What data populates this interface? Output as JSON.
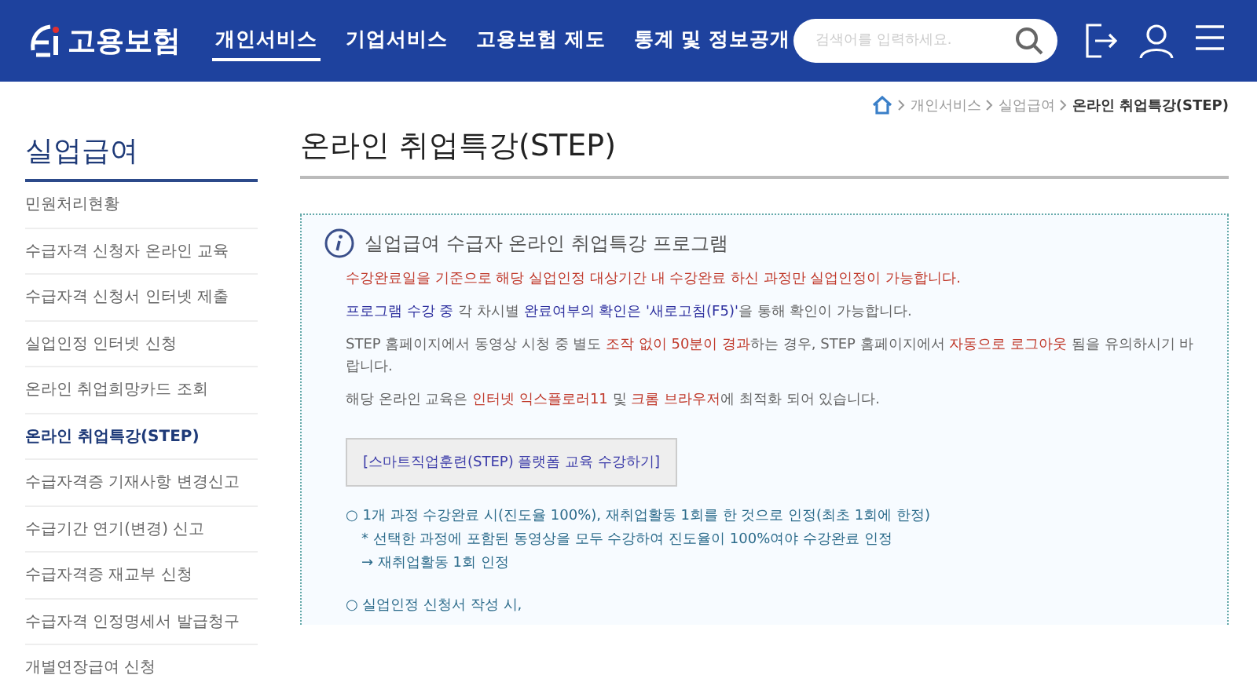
{
  "header": {
    "logo": "고용보험",
    "nav": [
      {
        "label": "개인서비스",
        "selected": true
      },
      {
        "label": "기업서비스",
        "selected": false
      },
      {
        "label": "고용보험 제도",
        "selected": false
      },
      {
        "label": "통계 및 정보공개",
        "selected": false
      }
    ],
    "search": {
      "placeholder": "검색어를 입력하세요."
    }
  },
  "sidebar": {
    "title": "실업급여",
    "items": [
      {
        "label": "민원처리현황",
        "selected": false
      },
      {
        "label": "수급자격 신청자 온라인 교육",
        "selected": false
      },
      {
        "label": "수급자격 신청서 인터넷 제출",
        "selected": false
      },
      {
        "label": "실업인정 인터넷 신청",
        "selected": false
      },
      {
        "label": "온라인 취업희망카드 조회",
        "selected": false
      },
      {
        "label": "온라인 취업특강(STEP)",
        "selected": true
      },
      {
        "label": "수급자격증 기재사항 변경신고",
        "selected": false
      },
      {
        "label": "수급기간 연기(변경) 신고",
        "selected": false
      },
      {
        "label": "수급자격증 재교부 신청",
        "selected": false
      },
      {
        "label": "수급자격 인정명세서 발급청구",
        "selected": false
      },
      {
        "label": "개별연장급여 신청",
        "selected": false
      }
    ]
  },
  "breadcrumb": [
    "개인서비스",
    "실업급여",
    "온라인 취업특강(STEP)"
  ],
  "page_title": "온라인 취업특강(STEP)",
  "notice": {
    "title": "실업급여 수급자 온라인 취업특강 프로그램",
    "paragraphs": [
      [
        {
          "text": "수강완료일을 기준으로 해당 실업인정 대상기간 내 수강완료 하신 과정만 실업인정이 가능합니다.",
          "color": "#c0392b"
        }
      ],
      [
        {
          "text": "프로그램 수강 중",
          "color": "#2d2f9e"
        },
        {
          "text": " 각 차시별 ",
          "color": "#666666"
        },
        {
          "text": "완료여부의 확인은 '새로고침(F5)'",
          "color": "#2d2f9e"
        },
        {
          "text": "을 통해 확인이 가능합니다.",
          "color": "#666666"
        }
      ],
      [
        {
          "text": "STEP 홈페이지에서 동영상 시청 중 별도 ",
          "color": "#666666"
        },
        {
          "text": "조작 없이 50분이 경과",
          "color": "#c0392b"
        },
        {
          "text": "하는 경우, STEP 홈페이지에서 ",
          "color": "#666666"
        },
        {
          "text": "자동으로 로그아웃",
          "color": "#c0392b"
        },
        {
          "text": " 됨을 유의하시기 바랍니다.",
          "color": "#666666"
        }
      ],
      [
        {
          "text": "해당 온라인 교육은 ",
          "color": "#666666"
        },
        {
          "text": "인터넷 익스플로러11",
          "color": "#c0392b"
        },
        {
          "text": " 및 ",
          "color": "#666666"
        },
        {
          "text": "크롬 브라우저",
          "color": "#c0392b"
        },
        {
          "text": "에 최적화 되어 있습니다.",
          "color": "#666666"
        }
      ]
    ],
    "button": "[스마트직업훈련(STEP) 플랫폼 교육 수강하기]",
    "details": [
      {
        "kind": "bullet",
        "text": "○ 1개 과정 수강완료 시(진도율 100%), 재취업활동 1회를 한 것으로 인정(최초 1회에 한정)"
      },
      {
        "kind": "sub",
        "text": "* 선택한 과정에 포함된 동영상을 모두 수강하여 진도율이 100%여야 수강완료 인정"
      },
      {
        "kind": "sub",
        "text": "→ 재취업활동 1회 인정"
      },
      {
        "kind": "gap",
        "text": "○ 실업인정 신청서 작성 시,"
      }
    ]
  }
}
